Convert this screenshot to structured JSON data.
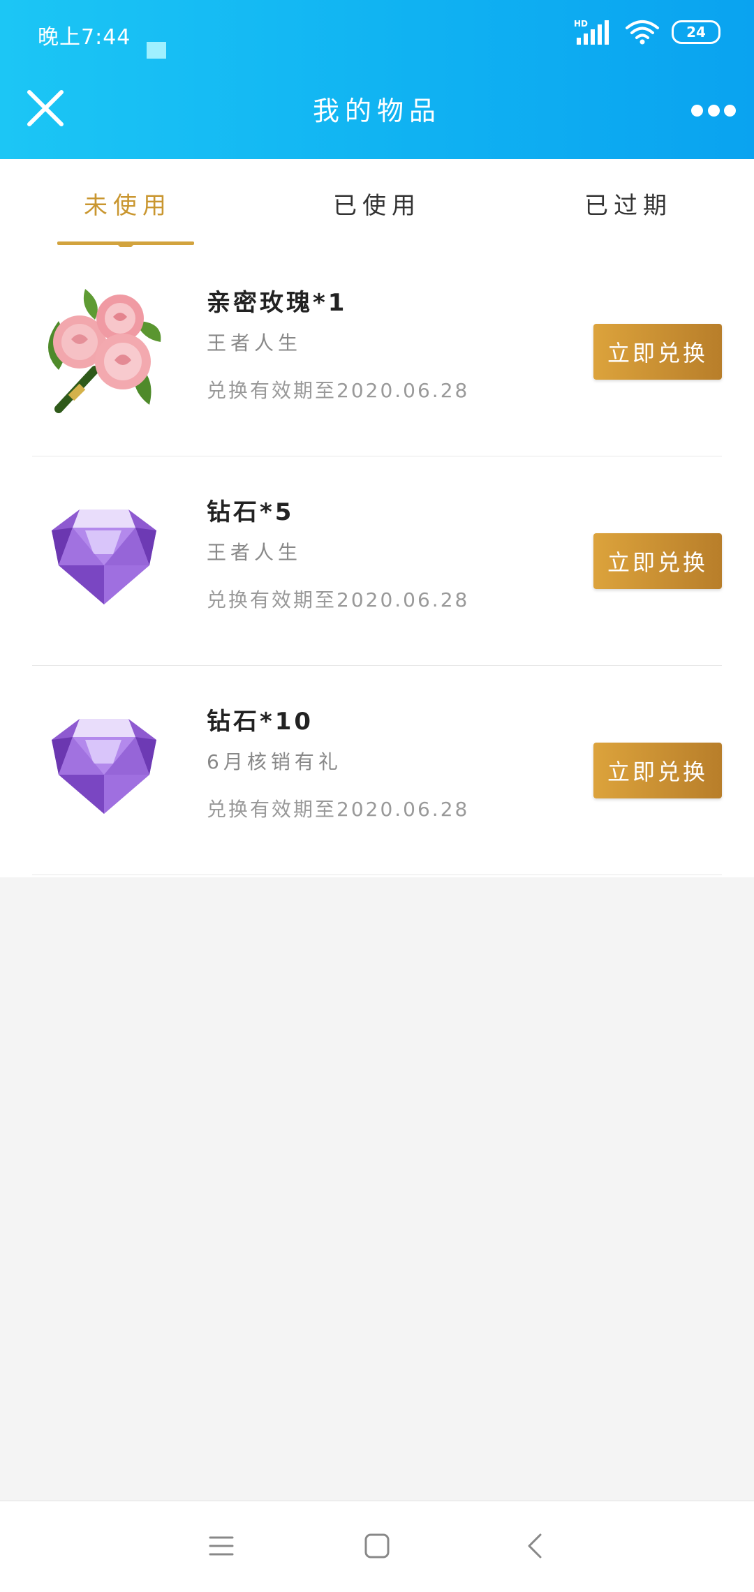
{
  "status_bar": {
    "time": "晚上7:44",
    "network_label": "HD",
    "battery": "24"
  },
  "header": {
    "title": "我的物品",
    "background_color": "#10b2f2"
  },
  "tabs": [
    {
      "label": "未使用",
      "active": true
    },
    {
      "label": "已使用",
      "active": false
    },
    {
      "label": "已过期",
      "active": false
    }
  ],
  "accent_color": "#c9962f",
  "items": [
    {
      "name": "亲密玫瑰*1",
      "subtitle": "王者人生",
      "validity": "兑换有效期至2020.06.28",
      "button": "立即兑换",
      "icon": "rose-bouquet-icon"
    },
    {
      "name": "钻石*5",
      "subtitle": "王者人生",
      "validity": "兑换有效期至2020.06.28",
      "button": "立即兑换",
      "icon": "purple-diamond-icon"
    },
    {
      "name": "钻石*10",
      "subtitle": "6月核销有礼",
      "validity": "兑换有效期至2020.06.28",
      "button": "立即兑换",
      "icon": "purple-diamond-icon"
    }
  ],
  "nav_icons": [
    "menu-icon",
    "home-icon",
    "back-icon"
  ]
}
